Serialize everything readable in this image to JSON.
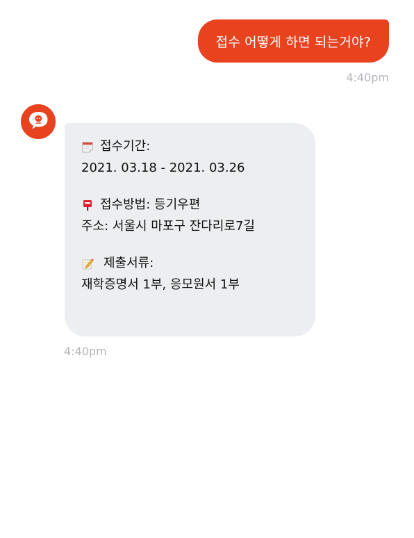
{
  "user_message": {
    "text": "접수 어떻게 하면 되는거야?",
    "time": "4:40pm"
  },
  "bot_message": {
    "avatar_icon": "chatbot-speech-bubble-icon",
    "period_icon": "calendar-icon",
    "period_label": "접수기간:",
    "period_value": "2021. 03.18 - 2021. 03.26",
    "method_icon": "mailbox-icon",
    "method_label": "접수방법: 등기우편",
    "address": "주소: 서울시 마포구 잔다리로7길",
    "docs_icon": "memo-pencil-icon",
    "docs_label": "제출서류:",
    "docs_value": "재학증명서 1부, 응모원서 1부",
    "time": "4:40pm"
  },
  "colors": {
    "accent": "#e8421f",
    "bot_bubble": "#eceef1",
    "timestamp": "#b4b6ba"
  }
}
